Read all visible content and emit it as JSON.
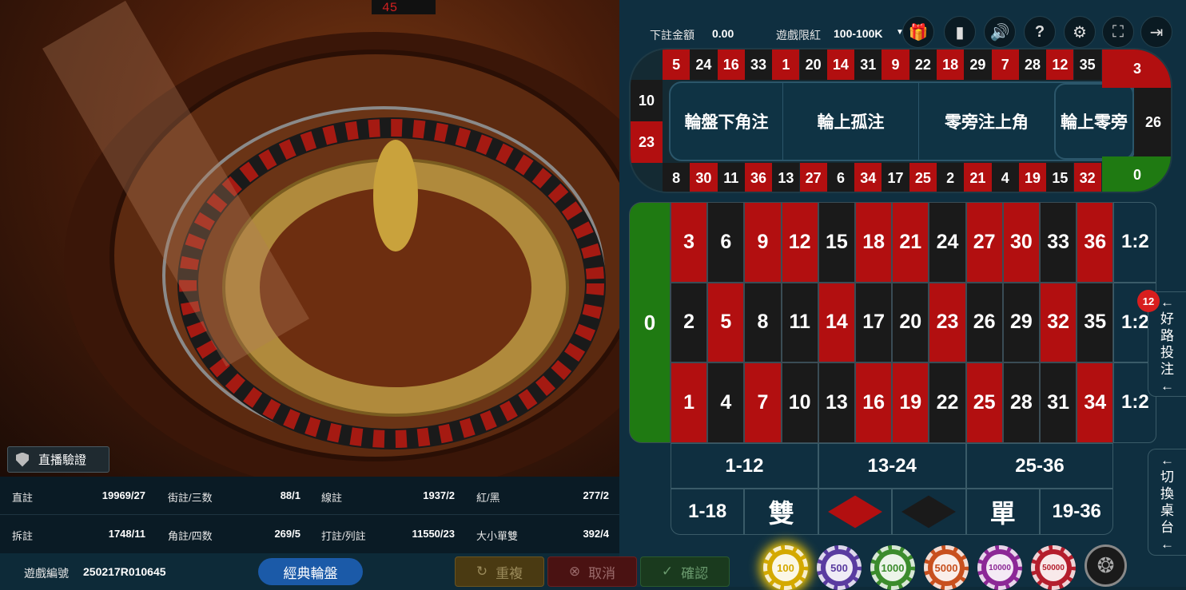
{
  "video": {
    "verify_label": "直播驗證",
    "dealer_display": "45"
  },
  "header": {
    "bet_amount_label": "下註金額",
    "bet_amount_value": "0.00",
    "limit_label": "遊戲限紅",
    "limit_value": "100-100K",
    "icons": [
      "gift-icon",
      "signal-icon",
      "volume-icon",
      "help-icon",
      "settings-icon",
      "fullscreen-icon",
      "exit-icon"
    ]
  },
  "racetrack": {
    "top": [
      "5",
      "24",
      "16",
      "33",
      "1",
      "20",
      "14",
      "31",
      "9",
      "22",
      "18",
      "29",
      "7",
      "28",
      "12",
      "35"
    ],
    "top_colors": [
      "red",
      "black",
      "red",
      "black",
      "red",
      "black",
      "red",
      "black",
      "red",
      "black",
      "red",
      "black",
      "red",
      "black",
      "red",
      "black"
    ],
    "right_top": "3",
    "right_mid": "26",
    "right_bottom": "0",
    "left_top": "10",
    "left_bottom": "23",
    "bottom": [
      "8",
      "30",
      "11",
      "36",
      "13",
      "27",
      "6",
      "34",
      "17",
      "25",
      "2",
      "21",
      "4",
      "19",
      "15",
      "32"
    ],
    "bottom_colors": [
      "black",
      "red",
      "black",
      "red",
      "black",
      "red",
      "black",
      "red",
      "black",
      "red",
      "black",
      "red",
      "black",
      "red",
      "black",
      "red"
    ],
    "sections": [
      "輪盤下角注",
      "輪上孤注",
      "零旁注上角",
      "輪上零旁"
    ]
  },
  "table": {
    "zero": "0",
    "rows": [
      [
        "3",
        "6",
        "9",
        "12",
        "15",
        "18",
        "21",
        "24",
        "27",
        "30",
        "33",
        "36"
      ],
      [
        "2",
        "5",
        "8",
        "11",
        "14",
        "17",
        "20",
        "23",
        "26",
        "29",
        "32",
        "35"
      ],
      [
        "1",
        "4",
        "7",
        "10",
        "13",
        "16",
        "19",
        "22",
        "25",
        "28",
        "31",
        "34"
      ]
    ],
    "colors": [
      [
        "red",
        "black",
        "red",
        "red",
        "black",
        "red",
        "red",
        "black",
        "red",
        "red",
        "black",
        "red"
      ],
      [
        "black",
        "red",
        "black",
        "black",
        "red",
        "black",
        "black",
        "red",
        "black",
        "black",
        "red",
        "black"
      ],
      [
        "red",
        "black",
        "red",
        "black",
        "black",
        "red",
        "red",
        "black",
        "red",
        "black",
        "black",
        "red"
      ]
    ],
    "column_bets": [
      "1:2",
      "1:2",
      "1:2"
    ],
    "dozens": [
      "1-12",
      "13-24",
      "25-36"
    ],
    "even_money": {
      "low": "1-18",
      "even": "雙",
      "odd": "單",
      "high": "19-36"
    },
    "red_color": "#b20f10",
    "black_color": "#1a1a1a",
    "green_color": "#1f7a12"
  },
  "side_tabs": {
    "good_road": {
      "label": [
        "好",
        "路",
        "投",
        "注"
      ],
      "badge": "12"
    },
    "switch_table": {
      "label": [
        "切",
        "換",
        "桌",
        "台"
      ]
    }
  },
  "stats": [
    {
      "label": "直註",
      "value": "19969/27"
    },
    {
      "label": "街註/三数",
      "value": "88/1"
    },
    {
      "label": "線註",
      "value": "1937/2"
    },
    {
      "label": "紅/黑",
      "value": "277/2"
    },
    {
      "label": "拆註",
      "value": "1748/11"
    },
    {
      "label": "角註/四数",
      "value": "269/5"
    },
    {
      "label": "打註/列註",
      "value": "11550/23"
    },
    {
      "label": "大小單雙",
      "value": "392/4"
    }
  ],
  "footer": {
    "game_no_label": "遊戲編號",
    "game_no": "250217R010645",
    "classic_label": "經典輪盤",
    "repeat_label": "重複",
    "cancel_label": "取消",
    "confirm_label": "確認"
  },
  "chips": [
    {
      "value": "100",
      "color": "#d4a900"
    },
    {
      "value": "500",
      "color": "#5a3ca0"
    },
    {
      "value": "1000",
      "color": "#3c8c2d"
    },
    {
      "value": "5000",
      "color": "#c8501e"
    },
    {
      "value": "10000",
      "color": "#8c2896"
    },
    {
      "value": "50000",
      "color": "#b41e2d"
    }
  ]
}
